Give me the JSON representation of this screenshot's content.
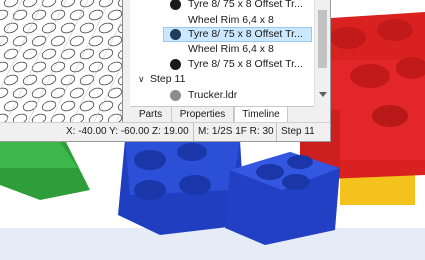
{
  "timeline": {
    "rows": [
      {
        "type": "part",
        "label": "Tyre  8/ 75 x  8 Offset Tr...",
        "dot": "black"
      },
      {
        "type": "sub",
        "label": "Wheel Rim  6,4 x  8"
      },
      {
        "type": "part",
        "label": "Tyre  8/ 75 x  8 Offset Tr...",
        "dot": "blue",
        "selected": true
      },
      {
        "type": "sub",
        "label": "Wheel Rim  6,4 x  8"
      },
      {
        "type": "part",
        "label": "Tyre  8/ 75 x  8 Offset Tr...",
        "dot": "black"
      },
      {
        "type": "step",
        "label": "Step 11"
      },
      {
        "type": "part",
        "label": "Trucker.ldr",
        "dot": "gray"
      }
    ]
  },
  "tabs": [
    "Parts",
    "Properties",
    "Timeline"
  ],
  "active_tab": "Timeline",
  "status": {
    "coords": "X: -40.00 Y: -60.00 Z: 19.00",
    "mode": "M: 1/2S 1F R: 30",
    "step": "Step 11"
  },
  "colors": {
    "selection": "#cce8ff",
    "brick_red": "#e3262a",
    "brick_blue": "#1f3fc0",
    "brick_green": "#2f9e3a",
    "brick_yellow": "#f4c21d"
  }
}
